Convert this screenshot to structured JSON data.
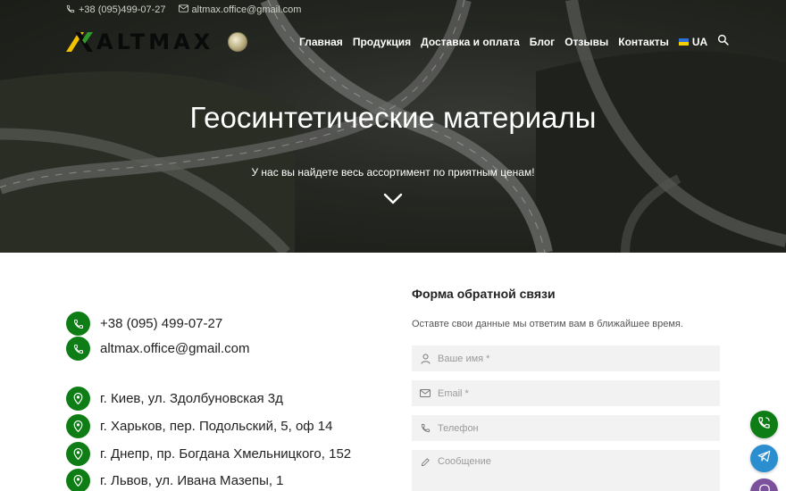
{
  "topbar": {
    "phone": "+38 (095)499-07-27",
    "email": "altmax.office@gmail.com"
  },
  "logo": {
    "text": "ALTMAX"
  },
  "nav": {
    "items": [
      "Главная",
      "Продукция",
      "Доставка и оплата",
      "Блог",
      "Отзывы",
      "Контакты"
    ],
    "lang": "UA"
  },
  "hero": {
    "title": "Геосинтетические материалы",
    "subtitle": "У нас вы найдете весь ассортимент по приятным ценам!"
  },
  "contacts": {
    "phone": "+38 (095) 499-07-27",
    "email": "altmax.office@gmail.com",
    "addresses": [
      "г. Киев, ул. Здолбуновская 3д",
      "г. Харьков, пер. Подольский, 5, оф 14",
      "г. Днепр, пр. Богдана Хмельницкого, 152",
      "г. Львов, ул. Ивана Мазепы, 1"
    ]
  },
  "form": {
    "title": "Форма обратной связи",
    "subtitle": "Оставте свои данные мы ответим вам в ближайшее время.",
    "name_placeholder": "Ваше имя *",
    "email_placeholder": "Email *",
    "phone_placeholder": "Телефон",
    "message_placeholder": "Сообщение"
  },
  "colors": {
    "accent_green": "#0e7d16",
    "logo_yellow": "#f2c100",
    "telegram": "#2b8fcf",
    "viber": "#7b519d"
  },
  "icons": [
    "phone-icon",
    "mail-icon",
    "search-icon",
    "chevron-down-icon",
    "map-pin-icon",
    "user-icon",
    "pencil-icon",
    "telegram-icon",
    "viber-icon"
  ]
}
